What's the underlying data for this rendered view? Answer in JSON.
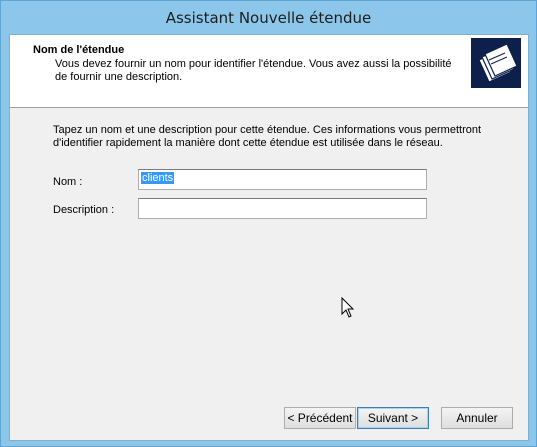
{
  "window": {
    "title": "Assistant Nouvelle étendue"
  },
  "header": {
    "title": "Nom de l'étendue",
    "description": "Vous devez fournir un nom pour identifier l'étendue. Vous avez aussi la possibilité de fournir une description.",
    "icon": "folders-icon"
  },
  "body": {
    "intro": "Tapez un nom et une description pour cette étendue. Ces informations vous permettront d'identifier rapidement la manière dont cette étendue est utilisée dans le réseau.",
    "name_label": "Nom :",
    "name_value": "clients",
    "description_label": "Description :",
    "description_value": ""
  },
  "buttons": {
    "previous": "< Précédent",
    "next": "Suivant >",
    "cancel": "Annuler"
  },
  "colors": {
    "titlebar": "#8cc6ea",
    "selection": "#3399ff",
    "icon_bg": "#0d1f4a"
  }
}
